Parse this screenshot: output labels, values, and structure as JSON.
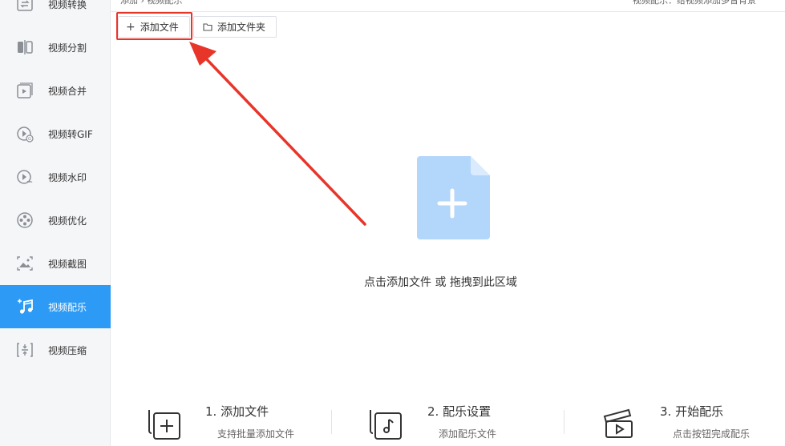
{
  "header": {
    "top_left_text": "添加 › 视频配乐",
    "top_right_text": "视频配乐：给视频添加多音背景"
  },
  "sidebar": {
    "items": [
      {
        "label": "视频转换",
        "icon": "convert-icon"
      },
      {
        "label": "视频分割",
        "icon": "split-icon"
      },
      {
        "label": "视频合并",
        "icon": "merge-icon"
      },
      {
        "label": "视频转GIF",
        "icon": "gif-icon"
      },
      {
        "label": "视频水印",
        "icon": "watermark-icon"
      },
      {
        "label": "视频优化",
        "icon": "film-reel-icon"
      },
      {
        "label": "视频截图",
        "icon": "image-icon"
      },
      {
        "label": "视频配乐",
        "icon": "music-add-icon",
        "active": true
      },
      {
        "label": "视频压缩",
        "icon": "compress-icon"
      }
    ]
  },
  "toolbar": {
    "add_file_label": "添加文件",
    "add_folder_label": "添加文件夹"
  },
  "dropzone": {
    "text": "点击添加文件 或 拖拽到此区域"
  },
  "steps": [
    {
      "title": "1. 添加文件",
      "desc": "支持批量添加文件",
      "icon": "add-file-icon"
    },
    {
      "title": "2. 配乐设置",
      "desc": "添加配乐文件",
      "icon": "music-note-icon"
    },
    {
      "title": "3. 开始配乐",
      "desc": "点击按钮完成配乐",
      "icon": "clapperboard-icon"
    }
  ],
  "colors": {
    "accent": "#2d9bf5",
    "highlight": "#e8352a",
    "drop_icon": "#b3d6fb"
  }
}
